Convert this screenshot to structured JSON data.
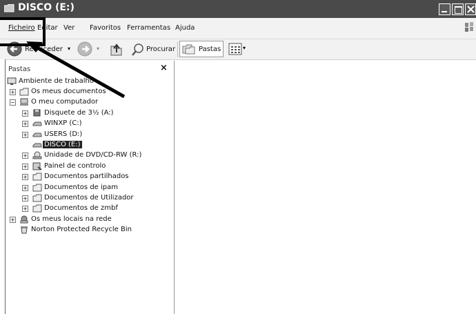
{
  "window": {
    "title": "DISCO (E:)"
  },
  "menu": {
    "items": [
      "Ficheiro",
      "Editar",
      "Ver",
      "Favoritos",
      "Ferramentas",
      "Ajuda"
    ]
  },
  "toolbar": {
    "back": "Retroceder",
    "search": "Procurar",
    "folders": "Pastas"
  },
  "pane": {
    "title": "Pastas",
    "close": "×",
    "tree": [
      {
        "label": "Ambiente de trabalho",
        "icon": "desktop-icon"
      },
      {
        "label": "Os meus documentos",
        "icon": "folder-icon",
        "expander": "+"
      },
      {
        "label": "O meu computador",
        "icon": "computer-icon",
        "expander": "−"
      },
      {
        "label": "Disquete de 3½ (A:)",
        "icon": "floppy-icon",
        "expander": "+"
      },
      {
        "label": "WINXP (C:)",
        "icon": "drive-icon",
        "expander": "+"
      },
      {
        "label": "USERS (D:)",
        "icon": "drive-icon",
        "expander": "+"
      },
      {
        "label": "DISCO (E:)",
        "icon": "drive-icon",
        "selected": true
      },
      {
        "label": "Unidade de DVD/CD-RW (R:)",
        "icon": "cd-drive-icon",
        "expander": "+"
      },
      {
        "label": "Painel de controlo",
        "icon": "control-panel-icon",
        "expander": "+"
      },
      {
        "label": "Documentos partilhados",
        "icon": "folder-icon",
        "expander": "+"
      },
      {
        "label": "Documentos de ipam",
        "icon": "folder-icon",
        "expander": "+"
      },
      {
        "label": "Documentos de Utilizador",
        "icon": "folder-icon",
        "expander": "+"
      },
      {
        "label": "Documentos de zmbf",
        "icon": "folder-icon",
        "expander": "+"
      },
      {
        "label": "Os meus locais na rede",
        "icon": "network-icon",
        "expander": "+"
      },
      {
        "label": "Norton Protected Recycle Bin",
        "icon": "recycle-bin-icon"
      }
    ]
  }
}
